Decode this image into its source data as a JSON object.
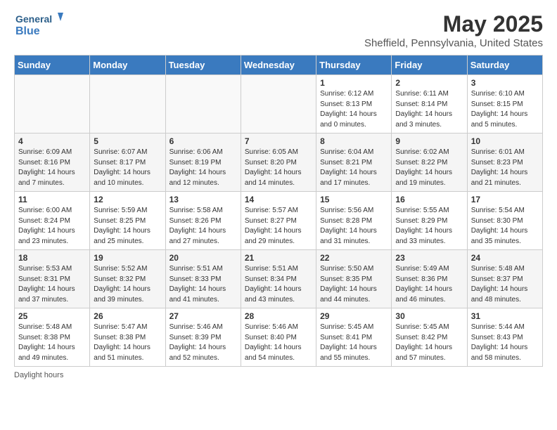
{
  "header": {
    "logo_line1": "General",
    "logo_line2": "Blue",
    "title": "May 2025",
    "subtitle": "Sheffield, Pennsylvania, United States"
  },
  "days_of_week": [
    "Sunday",
    "Monday",
    "Tuesday",
    "Wednesday",
    "Thursday",
    "Friday",
    "Saturday"
  ],
  "weeks": [
    [
      {
        "day": "",
        "info": ""
      },
      {
        "day": "",
        "info": ""
      },
      {
        "day": "",
        "info": ""
      },
      {
        "day": "",
        "info": ""
      },
      {
        "day": "1",
        "info": "Sunrise: 6:12 AM\nSunset: 8:13 PM\nDaylight: 14 hours\nand 0 minutes."
      },
      {
        "day": "2",
        "info": "Sunrise: 6:11 AM\nSunset: 8:14 PM\nDaylight: 14 hours\nand 3 minutes."
      },
      {
        "day": "3",
        "info": "Sunrise: 6:10 AM\nSunset: 8:15 PM\nDaylight: 14 hours\nand 5 minutes."
      }
    ],
    [
      {
        "day": "4",
        "info": "Sunrise: 6:09 AM\nSunset: 8:16 PM\nDaylight: 14 hours\nand 7 minutes."
      },
      {
        "day": "5",
        "info": "Sunrise: 6:07 AM\nSunset: 8:17 PM\nDaylight: 14 hours\nand 10 minutes."
      },
      {
        "day": "6",
        "info": "Sunrise: 6:06 AM\nSunset: 8:19 PM\nDaylight: 14 hours\nand 12 minutes."
      },
      {
        "day": "7",
        "info": "Sunrise: 6:05 AM\nSunset: 8:20 PM\nDaylight: 14 hours\nand 14 minutes."
      },
      {
        "day": "8",
        "info": "Sunrise: 6:04 AM\nSunset: 8:21 PM\nDaylight: 14 hours\nand 17 minutes."
      },
      {
        "day": "9",
        "info": "Sunrise: 6:02 AM\nSunset: 8:22 PM\nDaylight: 14 hours\nand 19 minutes."
      },
      {
        "day": "10",
        "info": "Sunrise: 6:01 AM\nSunset: 8:23 PM\nDaylight: 14 hours\nand 21 minutes."
      }
    ],
    [
      {
        "day": "11",
        "info": "Sunrise: 6:00 AM\nSunset: 8:24 PM\nDaylight: 14 hours\nand 23 minutes."
      },
      {
        "day": "12",
        "info": "Sunrise: 5:59 AM\nSunset: 8:25 PM\nDaylight: 14 hours\nand 25 minutes."
      },
      {
        "day": "13",
        "info": "Sunrise: 5:58 AM\nSunset: 8:26 PM\nDaylight: 14 hours\nand 27 minutes."
      },
      {
        "day": "14",
        "info": "Sunrise: 5:57 AM\nSunset: 8:27 PM\nDaylight: 14 hours\nand 29 minutes."
      },
      {
        "day": "15",
        "info": "Sunrise: 5:56 AM\nSunset: 8:28 PM\nDaylight: 14 hours\nand 31 minutes."
      },
      {
        "day": "16",
        "info": "Sunrise: 5:55 AM\nSunset: 8:29 PM\nDaylight: 14 hours\nand 33 minutes."
      },
      {
        "day": "17",
        "info": "Sunrise: 5:54 AM\nSunset: 8:30 PM\nDaylight: 14 hours\nand 35 minutes."
      }
    ],
    [
      {
        "day": "18",
        "info": "Sunrise: 5:53 AM\nSunset: 8:31 PM\nDaylight: 14 hours\nand 37 minutes."
      },
      {
        "day": "19",
        "info": "Sunrise: 5:52 AM\nSunset: 8:32 PM\nDaylight: 14 hours\nand 39 minutes."
      },
      {
        "day": "20",
        "info": "Sunrise: 5:51 AM\nSunset: 8:33 PM\nDaylight: 14 hours\nand 41 minutes."
      },
      {
        "day": "21",
        "info": "Sunrise: 5:51 AM\nSunset: 8:34 PM\nDaylight: 14 hours\nand 43 minutes."
      },
      {
        "day": "22",
        "info": "Sunrise: 5:50 AM\nSunset: 8:35 PM\nDaylight: 14 hours\nand 44 minutes."
      },
      {
        "day": "23",
        "info": "Sunrise: 5:49 AM\nSunset: 8:36 PM\nDaylight: 14 hours\nand 46 minutes."
      },
      {
        "day": "24",
        "info": "Sunrise: 5:48 AM\nSunset: 8:37 PM\nDaylight: 14 hours\nand 48 minutes."
      }
    ],
    [
      {
        "day": "25",
        "info": "Sunrise: 5:48 AM\nSunset: 8:38 PM\nDaylight: 14 hours\nand 49 minutes."
      },
      {
        "day": "26",
        "info": "Sunrise: 5:47 AM\nSunset: 8:38 PM\nDaylight: 14 hours\nand 51 minutes."
      },
      {
        "day": "27",
        "info": "Sunrise: 5:46 AM\nSunset: 8:39 PM\nDaylight: 14 hours\nand 52 minutes."
      },
      {
        "day": "28",
        "info": "Sunrise: 5:46 AM\nSunset: 8:40 PM\nDaylight: 14 hours\nand 54 minutes."
      },
      {
        "day": "29",
        "info": "Sunrise: 5:45 AM\nSunset: 8:41 PM\nDaylight: 14 hours\nand 55 minutes."
      },
      {
        "day": "30",
        "info": "Sunrise: 5:45 AM\nSunset: 8:42 PM\nDaylight: 14 hours\nand 57 minutes."
      },
      {
        "day": "31",
        "info": "Sunrise: 5:44 AM\nSunset: 8:43 PM\nDaylight: 14 hours\nand 58 minutes."
      }
    ]
  ],
  "footer": "Daylight hours"
}
